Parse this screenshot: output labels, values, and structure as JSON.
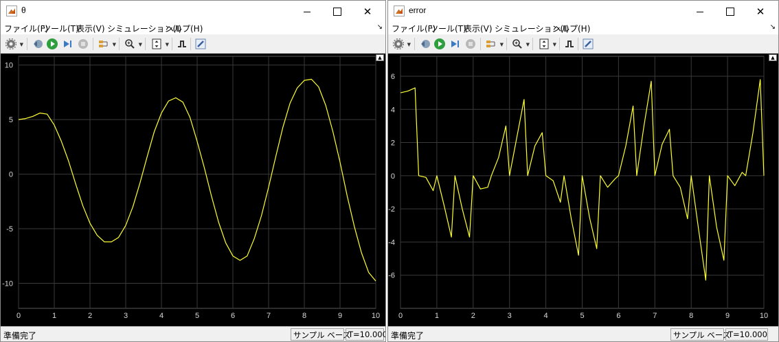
{
  "windows": [
    {
      "title": "θ",
      "menu": [
        "ファイル(F)",
        "ツール(T)",
        "表示(V)",
        "シミュレーション(I)",
        "ヘルプ(H)"
      ],
      "status": {
        "state": "準備完了",
        "mode": "サンプル ベース",
        "time": "T=10.000"
      }
    },
    {
      "title": "error",
      "menu": [
        "ファイル(F)",
        "ツール(T)",
        "表示(V)",
        "シミュレーション(I)",
        "ヘルプ(H)"
      ],
      "status": {
        "state": "準備完了",
        "mode": "サンプル ベース",
        "time": "T=10.000"
      }
    }
  ],
  "toolbar_icons": [
    "gear-icon",
    "rewind-icon",
    "run-icon",
    "step-forward-icon",
    "stop-icon",
    "highlight-icon",
    "zoom-icon",
    "fit-axes-icon",
    "trigger-icon",
    "style-icon"
  ],
  "colors": {
    "trace": "#ffff33",
    "grid": "#3a3a3a",
    "plot_bg": "#000000"
  },
  "chart_data": [
    {
      "type": "line",
      "series": [
        {
          "x": [
            0,
            0.2,
            0.4,
            0.6,
            0.8,
            1.0,
            1.2,
            1.4,
            1.6,
            1.8,
            2.0,
            2.2,
            2.4,
            2.6,
            2.8,
            3.0,
            3.2,
            3.4,
            3.6,
            3.8,
            4.0,
            4.2,
            4.4,
            4.6,
            4.8,
            5.0,
            5.2,
            5.4,
            5.6,
            5.8,
            6.0,
            6.2,
            6.4,
            6.6,
            6.8,
            7.0,
            7.2,
            7.4,
            7.6,
            7.8,
            8.0,
            8.2,
            8.4,
            8.6,
            8.8,
            9.0,
            9.2,
            9.4,
            9.6,
            9.8,
            10.0
          ],
          "y": [
            5.0,
            5.1,
            5.3,
            5.6,
            5.5,
            4.5,
            3.0,
            1.2,
            -0.9,
            -2.9,
            -4.5,
            -5.6,
            -6.2,
            -6.2,
            -5.8,
            -4.7,
            -3.0,
            -0.8,
            1.6,
            3.9,
            5.6,
            6.7,
            7.0,
            6.6,
            5.2,
            3.0,
            0.6,
            -2.0,
            -4.4,
            -6.3,
            -7.5,
            -7.9,
            -7.5,
            -5.9,
            -3.8,
            -1.2,
            1.6,
            4.3,
            6.5,
            7.9,
            8.6,
            8.7,
            8.0,
            6.3,
            3.9,
            1.1,
            -2.0,
            -4.8,
            -7.2,
            -9.0,
            -9.8
          ]
        }
      ],
      "xlim": [
        0,
        10
      ],
      "ylim": [
        -12.3,
        10.8
      ],
      "xticks": [
        "0",
        "1",
        "2",
        "3",
        "4",
        "5",
        "6",
        "7",
        "8",
        "9",
        "10"
      ],
      "yticks": [
        "10",
        "5",
        "0",
        "-5",
        "-10"
      ],
      "grid": true
    },
    {
      "type": "line",
      "series": [
        {
          "x": [
            0,
            0.2,
            0.4,
            0.5,
            0.7,
            0.9,
            1.0,
            1.2,
            1.4,
            1.5,
            1.7,
            1.9,
            2.0,
            2.2,
            2.4,
            2.5,
            2.7,
            2.9,
            3.0,
            3.2,
            3.4,
            3.5,
            3.7,
            3.9,
            4.0,
            4.2,
            4.4,
            4.5,
            4.7,
            4.9,
            5.0,
            5.2,
            5.4,
            5.5,
            5.7,
            5.9,
            6.0,
            6.2,
            6.4,
            6.5,
            6.7,
            6.9,
            7.0,
            7.2,
            7.4,
            7.5,
            7.7,
            7.9,
            8.0,
            8.2,
            8.4,
            8.5,
            8.7,
            8.9,
            9.0,
            9.2,
            9.4,
            9.5,
            9.7,
            9.9,
            10.0
          ],
          "y": [
            5.0,
            5.1,
            5.3,
            0.0,
            -0.1,
            -0.9,
            0.0,
            -1.8,
            -3.7,
            0.0,
            -2.0,
            -3.7,
            0.0,
            -0.8,
            -0.7,
            0.0,
            1.1,
            3.0,
            0.0,
            2.3,
            4.6,
            0.0,
            1.8,
            2.6,
            0.0,
            -0.3,
            -1.6,
            0.0,
            -2.6,
            -4.8,
            0.0,
            -2.5,
            -4.4,
            0.0,
            -0.7,
            -0.2,
            0.0,
            1.8,
            4.2,
            0.0,
            3.0,
            5.7,
            0.0,
            1.9,
            2.8,
            0.0,
            -0.7,
            -2.6,
            0.0,
            -3.2,
            -6.3,
            0.0,
            -3.1,
            -5.1,
            0.0,
            -0.6,
            0.2,
            0.0,
            2.6,
            5.8,
            0.0
          ]
        }
      ],
      "xlim": [
        0,
        10
      ],
      "ylim": [
        -8.0,
        7.2
      ],
      "xticks": [
        "0",
        "1",
        "2",
        "3",
        "4",
        "5",
        "6",
        "7",
        "8",
        "9",
        "10"
      ],
      "yticks": [
        "6",
        "4",
        "2",
        "0",
        "-2",
        "-4",
        "-6"
      ],
      "grid": true
    }
  ]
}
